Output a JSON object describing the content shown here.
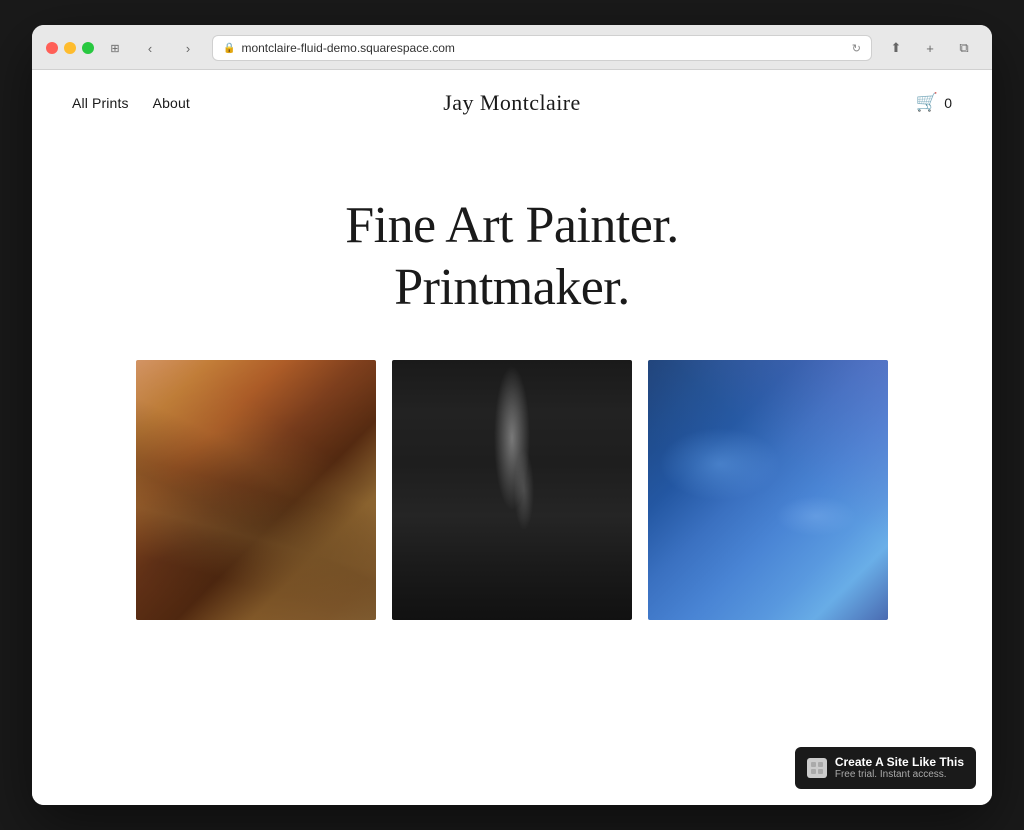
{
  "browser": {
    "url": "montclaire-fluid-demo.squarespace.com",
    "back_btn": "‹",
    "forward_btn": "›",
    "share_icon": "⬆",
    "new_tab_icon": "+",
    "duplicate_icon": "⧉"
  },
  "nav": {
    "left_links": [
      {
        "label": "All Prints",
        "id": "all-prints"
      },
      {
        "label": "About",
        "id": "about"
      }
    ],
    "site_title": "Jay Montclaire",
    "cart_count": "0"
  },
  "hero": {
    "line1": "Fine Art Painter.",
    "line2": "Printmaker."
  },
  "gallery": {
    "items": [
      {
        "id": "artwork-1",
        "alt": "Golden warm abstract artwork"
      },
      {
        "id": "artwork-2",
        "alt": "Dark black abstract artwork with light streaks"
      },
      {
        "id": "artwork-3",
        "alt": "Blue fluid abstract artwork"
      }
    ]
  },
  "badge": {
    "logo_text": "S",
    "title": "Create A Site Like This",
    "subtitle": "Free trial. Instant access."
  }
}
